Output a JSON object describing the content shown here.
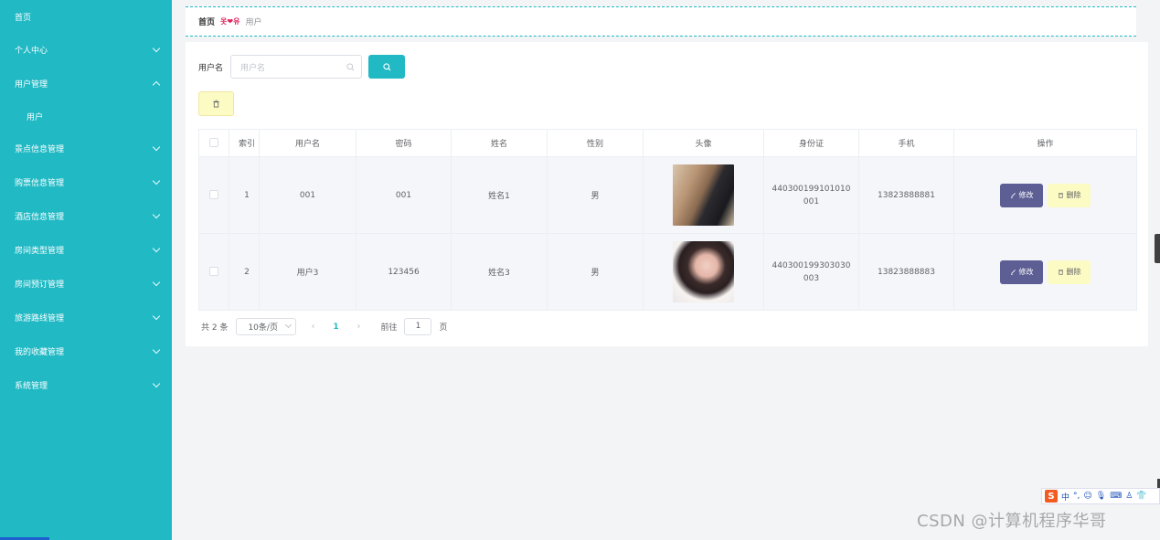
{
  "sidebar": {
    "items": [
      {
        "label": "首页"
      },
      {
        "label": "个人中心"
      },
      {
        "label": "用户管理"
      },
      {
        "label": "用户"
      },
      {
        "label": "景点信息管理"
      },
      {
        "label": "购票信息管理"
      },
      {
        "label": "酒店信息管理"
      },
      {
        "label": "房间类型管理"
      },
      {
        "label": "房间预订管理"
      },
      {
        "label": "旅游路线管理"
      },
      {
        "label": "我的收藏管理"
      },
      {
        "label": "系统管理"
      }
    ]
  },
  "breadcrumb": {
    "home": "首页",
    "separator": "옷❤유",
    "current": "用户"
  },
  "search": {
    "label": "用户名",
    "placeholder": "用户名"
  },
  "table": {
    "headers": [
      "索引",
      "用户名",
      "密码",
      "姓名",
      "性别",
      "头像",
      "身份证",
      "手机",
      "操作"
    ],
    "rows": [
      {
        "index": "1",
        "username": "001",
        "password": "001",
        "name": "姓名1",
        "gender": "男",
        "id_card": "440300199101010001",
        "phone": "13823888881"
      },
      {
        "index": "2",
        "username": "用户3",
        "password": "123456",
        "name": "姓名3",
        "gender": "男",
        "id_card": "440300199303030003",
        "phone": "13823888883"
      }
    ],
    "edit_label": "修改",
    "delete_label": "删除"
  },
  "pagination": {
    "total": "共 2 条",
    "page_size": "10条/页",
    "current_page": "1",
    "goto_label": "前往",
    "goto_value": "1",
    "page_suffix": "页"
  },
  "ime": {
    "lang": "中"
  },
  "watermark": "CSDN @计算机程序华哥",
  "colors": {
    "accent": "#20b9c4",
    "edit_button": "#5c5e94",
    "delete_button": "#fdfbc4"
  }
}
